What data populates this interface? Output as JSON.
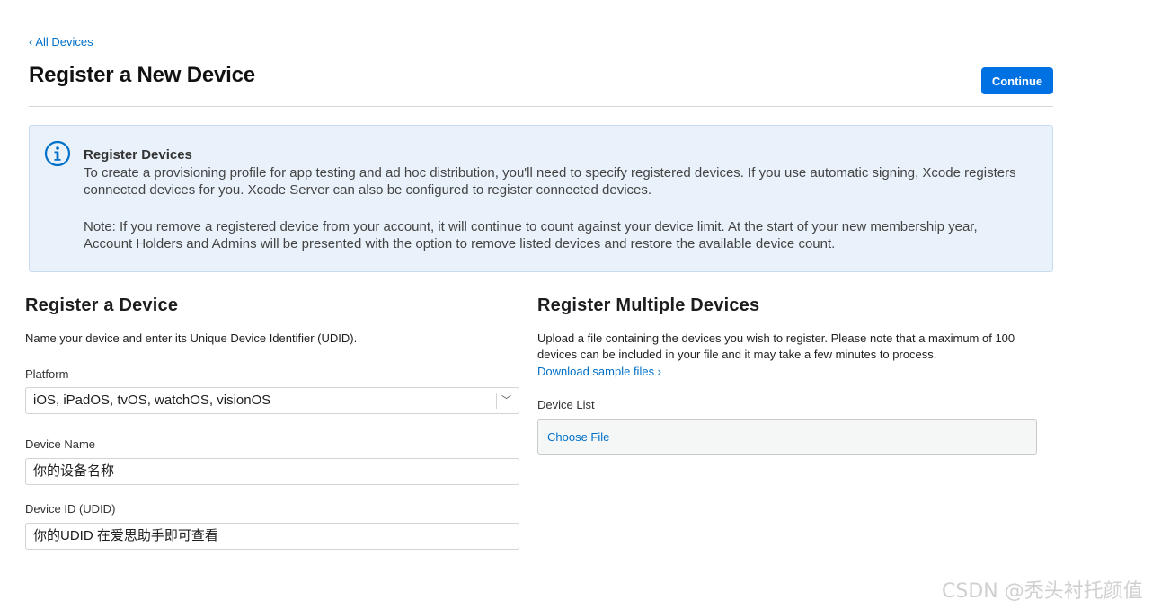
{
  "nav": {
    "back_label": "All Devices",
    "back_chevron": "‹"
  },
  "header": {
    "title": "Register a New Device",
    "continue_label": "Continue"
  },
  "info": {
    "icon": "info-circle-icon",
    "title": "Register Devices",
    "text": "To create a provisioning profile for app testing and ad hoc distribution, you'll need to specify registered devices. If you use automatic signing, Xcode registers connected devices for you. Xcode Server can also be configured to register connected devices.",
    "note": "Note: If you remove a registered device from your account, it will continue to count against your device limit. At the start of your new membership year, Account Holders and Admins will be presented with the option to remove listed devices and restore the available device count."
  },
  "single": {
    "title": "Register a Device",
    "description": "Name your device and enter its Unique Device Identifier (UDID).",
    "platform_label": "Platform",
    "platform_value": "iOS, iPadOS, tvOS, watchOS, visionOS",
    "name_label": "Device Name",
    "name_value": "你的设备名称",
    "udid_label": "Device ID (UDID)",
    "udid_value": "你的UDID 在爱思助手即可查看"
  },
  "multiple": {
    "title": "Register Multiple Devices",
    "description": "Upload a file containing the devices you wish to register. Please note that a maximum of 100 devices can be included in your file and it may take a few minutes to process.",
    "download_label": "Download sample files ›",
    "list_label": "Device List",
    "choose_file_label": "Choose File"
  },
  "watermark": "CSDN @秃头衬托颜值",
  "colors": {
    "accent": "#0071e3",
    "link": "#0070c9",
    "info_bg": "#e9f2fa"
  }
}
